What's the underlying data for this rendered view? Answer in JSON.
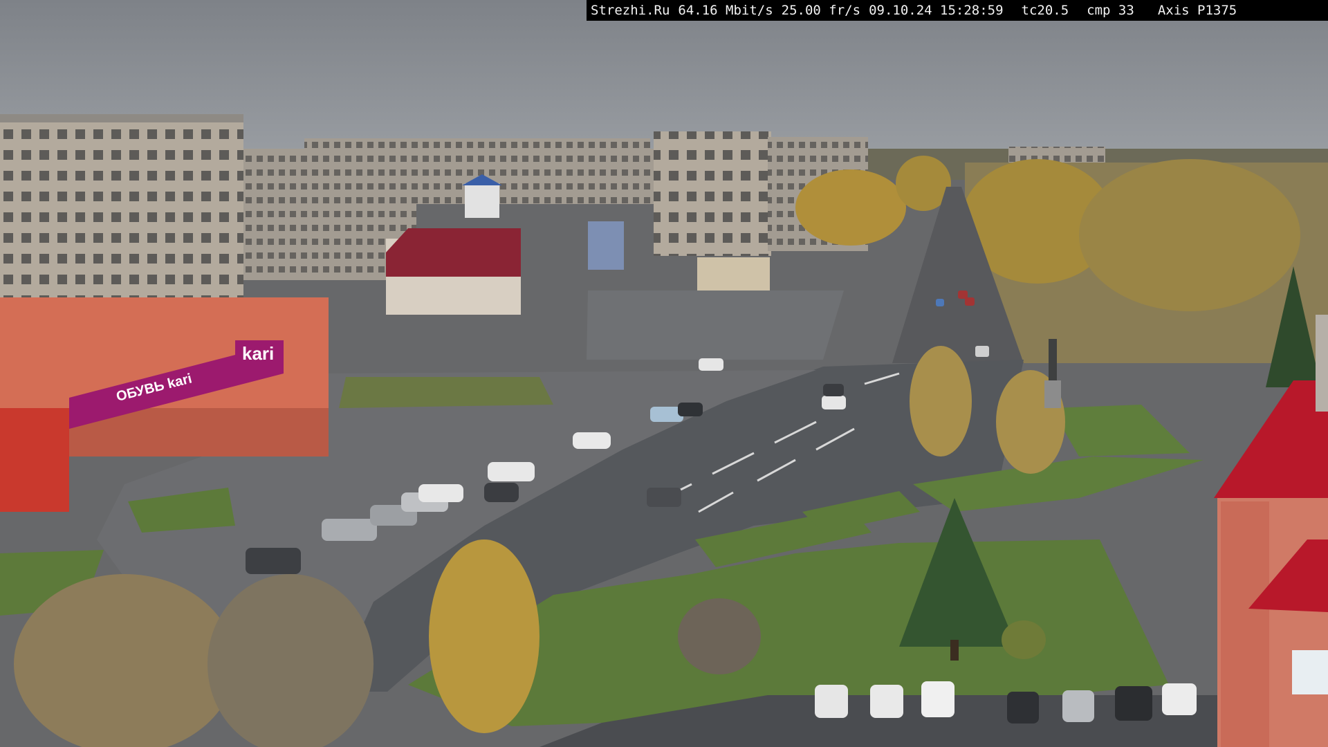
{
  "overlay": {
    "site": "Strezhi.Ru",
    "bandwidth": "64.16 Mbit/s",
    "framerate": "25.00 fr/s",
    "datetime": "09.10.24 15:28:59",
    "tc": "tc20.5",
    "cmp": "cmp 33",
    "camera": "Axis P1375"
  },
  "signs": {
    "store_logo": "kari",
    "store_banner": "ОБУВЬ kari"
  },
  "colors": {
    "sky": "#888c92",
    "road": "#56595e",
    "grass": "#5d7a3a",
    "autumn_leaves": "#b8973e",
    "brand_magenta": "#9c1a6e",
    "roof_red": "#b8182a"
  }
}
